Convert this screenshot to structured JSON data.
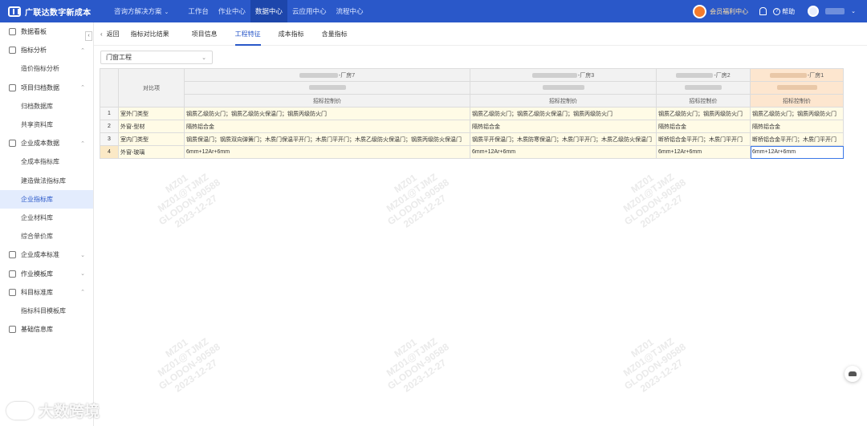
{
  "app": {
    "title": "广联达数字新成本"
  },
  "topnav": {
    "items": [
      {
        "label": "咨询方解决方案",
        "caret": "⌄"
      },
      {
        "label": "工作台"
      },
      {
        "label": "作业中心"
      },
      {
        "label": "数据中心"
      },
      {
        "label": "云应用中心"
      },
      {
        "label": "流程中心"
      }
    ],
    "vip": "会员福利中心",
    "help": "帮助",
    "help_icon": "?",
    "user_caret": "⌄"
  },
  "sidebar": {
    "collapse": "‹",
    "items": [
      {
        "label": "数据看板"
      },
      {
        "label": "指标分析",
        "arrow": "⌃"
      },
      {
        "label": "造价指标分析"
      },
      {
        "label": "项目归档数据",
        "arrow": "⌃"
      },
      {
        "label": "归档数据库"
      },
      {
        "label": "共享资料库"
      },
      {
        "label": "企业成本数据",
        "arrow": "⌃"
      },
      {
        "label": "全成本指标库"
      },
      {
        "label": "建造做法指标库"
      },
      {
        "label": "企业指标库"
      },
      {
        "label": "企业材料库"
      },
      {
        "label": "综合单价库"
      },
      {
        "label": "企业成本标准",
        "arrow": "⌄"
      },
      {
        "label": "作业模板库",
        "arrow": "⌄"
      },
      {
        "label": "科目标准库",
        "arrow": "⌃"
      },
      {
        "label": "指标科目模板库"
      },
      {
        "label": "基础信息库"
      }
    ]
  },
  "tabs": {
    "back_arrow": "‹",
    "back": "返回",
    "page_title": "指标对比结果",
    "items": [
      {
        "label": "项目信息"
      },
      {
        "label": "工程特征"
      },
      {
        "label": "成本指标"
      },
      {
        "label": "含量指标"
      }
    ]
  },
  "filter": {
    "value": "门窗工程",
    "caret": "⌄"
  },
  "table": {
    "compare_header": "对比项",
    "columns": [
      {
        "name": "-厂房7",
        "sub": "招标控制价"
      },
      {
        "name": "-厂房3",
        "sub": "招标控制价"
      },
      {
        "name": "-厂房2",
        "sub": "招标控制价"
      },
      {
        "name": "-厂房1",
        "sub": "招标控制价"
      }
    ],
    "rows": [
      {
        "no": "1",
        "item": "室外门类型",
        "values": [
          "钢质乙级防火门；钢质乙级防火保温门；钢质丙级防火门",
          "钢质乙级防火门；钢质乙级防火保温门；钢质丙级防火门",
          "钢质乙级防火门；钢质丙级防火门",
          "钢质乙级防火门；钢质丙级防火门"
        ]
      },
      {
        "no": "2",
        "item": "外窗-型材",
        "values": [
          "隔热铝合金",
          "隔热铝合金",
          "隔热铝合金",
          "隔热铝合金"
        ]
      },
      {
        "no": "3",
        "item": "室内门类型",
        "values": [
          "钢质保温门；钢质双向弹簧门；木质门保温平开门；木质门平开门；木质乙级防火保温门；钢质丙级防火保温门",
          "钢质平开保温门；木质防寒保温门；木质门平开门；木质乙级防火保温门",
          "断桥铝合金平开门；木质门平开门",
          "断桥铝合金平开门；木质门平开门"
        ]
      },
      {
        "no": "4",
        "item": "外窗-玻璃",
        "values": [
          "6mm+12Ar+6mm",
          "6mm+12Ar+6mm",
          "6mm+12Ar+6mm",
          "6mm+12Ar+6mm"
        ]
      }
    ]
  },
  "watermark": {
    "lines": [
      "MZ01",
      "MZ01@TJMZ",
      "GLODON-90588",
      "2023-12-27"
    ]
  },
  "brand_watermark": "大数跨境"
}
